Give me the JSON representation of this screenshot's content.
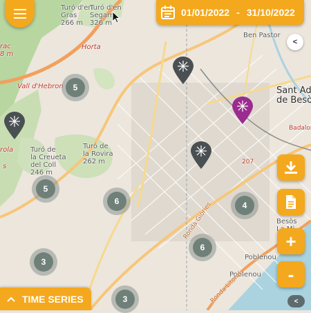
{
  "toolbar": {
    "date_start": "01/01/2022",
    "date_separator": "-",
    "date_end": "31/10/2022",
    "collapse_top_glyph": "<",
    "collapse_bottom_glyph": "<",
    "zoom_in_glyph": "+",
    "zoom_out_glyph": "-",
    "accent_color": "#f4a81d"
  },
  "time_series": {
    "label": "TIME SERIES"
  },
  "map_labels": {
    "turo_gras": "Turó d'en\nGras\n266 m",
    "turo_segarra": "Turó d'en\nSegarra\n326 m",
    "horta": "Horta",
    "vall_hebron": "Vall d'Hebron",
    "turo_creueta": "Turó de\nla Creueta\ndel Coll\n246 m",
    "turo_rovira": "Turó de\nla Rovira\n262 m",
    "ben_pastor": "Ben Pastor",
    "sant_adria": "Sant Adr\nde Besò",
    "badalona": "Badalon",
    "besos": "Besòs\nLa Mi",
    "poblenou1": "Poblenou",
    "poblenou2": "Poblenou",
    "ronda_glories": "Ronda Glòries",
    "ronda_litoral": "Ronda Litoral",
    "n207": "207",
    "left_rac": "rac\n8 m",
    "left_rola": "rola",
    "left_s": "s"
  },
  "clusters": [
    {
      "count": "5"
    },
    {
      "count": "5"
    },
    {
      "count": "6"
    },
    {
      "count": "4"
    },
    {
      "count": "6"
    },
    {
      "count": "3"
    },
    {
      "count": "3"
    }
  ],
  "pins": [
    {
      "color": "#4a4f52"
    },
    {
      "color": "#4a4f52"
    },
    {
      "color": "#4a4f52"
    },
    {
      "color": "#9b2c8f"
    }
  ],
  "icons": {
    "menu": "hamburger-icon",
    "calendar": "calendar-icon",
    "download": "download-icon",
    "document": "document-icon",
    "chevron_up": "chevron-up-icon"
  }
}
